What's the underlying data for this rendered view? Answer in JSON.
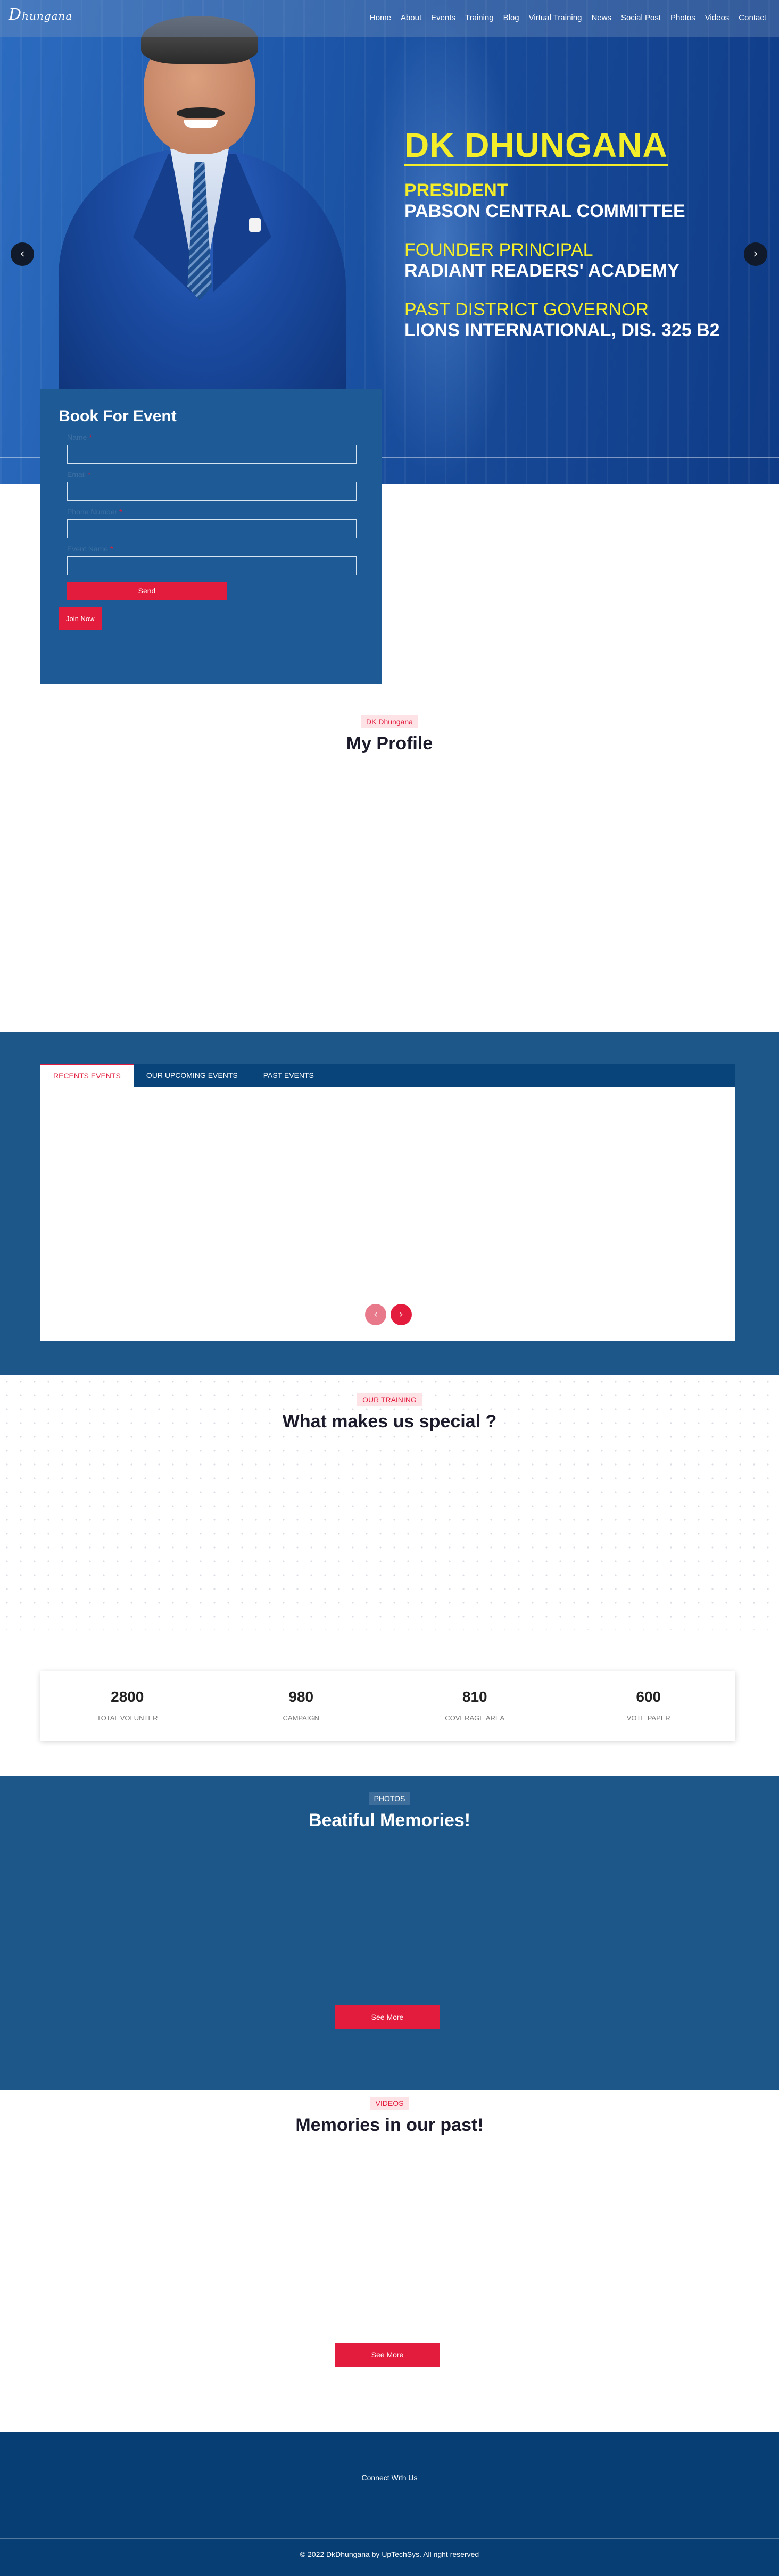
{
  "header": {
    "logo_text": "Dhungana",
    "nav": [
      "Home",
      "About",
      "Events",
      "Training",
      "Blog",
      "Virtual Training",
      "News",
      "Social Post",
      "Photos",
      "Videos",
      "Contact"
    ]
  },
  "hero": {
    "name": "DK DHUNGANA",
    "roles": [
      {
        "title": "PRESIDENT",
        "org": "PABSON CENTRAL COMMITTEE"
      },
      {
        "title": "FOUNDER PRINCIPAL",
        "org": "RADIANT READERS' ACADEMY"
      },
      {
        "title": "PAST DISTRICT GOVERNOR",
        "org": "LIONS INTERNATIONAL, DIS. 325 B2"
      }
    ],
    "prev_icon": "chevron-left-icon",
    "next_icon": "chevron-right-icon"
  },
  "book_form": {
    "title": "Book For Event",
    "fields": [
      {
        "label": "Name",
        "required": true,
        "value": ""
      },
      {
        "label": "Email",
        "required": true,
        "value": ""
      },
      {
        "label": "Phone Number",
        "required": true,
        "value": ""
      },
      {
        "label": "Event Name",
        "required": true,
        "value": ""
      }
    ],
    "send_label": "Send",
    "join_label": "Join Now"
  },
  "profile": {
    "tag": "DK Dhungana",
    "title": "My Profile"
  },
  "events": {
    "tabs": [
      "RECENTS EVENTS",
      "OUR UPCOMING EVENTS",
      "PAST EVENTS"
    ],
    "active_tab": 0
  },
  "training": {
    "tag": "OUR TRAINING",
    "title": "What makes us special ?"
  },
  "stats": [
    {
      "value": "2800",
      "label": "TOTAL VOLUNTER"
    },
    {
      "value": "980",
      "label": "CAMPAIGN"
    },
    {
      "value": "810",
      "label": "COVERAGE AREA"
    },
    {
      "value": "600",
      "label": "VOTE PAPER"
    }
  ],
  "photos": {
    "tag": "PHOTOS",
    "title": "Beatiful Memories!",
    "button": "See More"
  },
  "videos": {
    "tag": "VIDEOS",
    "title": "Memories in our past!",
    "button": "See More"
  },
  "footer": {
    "connect": "Connect With Us",
    "copyright": "© 2022 DkDhungana by UpTechSys. All right reserved"
  },
  "colors": {
    "brand_red": "#e31c3d",
    "navy": "#1d5688",
    "footer": "#073e73",
    "accent_yellow": "#f4ee2a"
  }
}
